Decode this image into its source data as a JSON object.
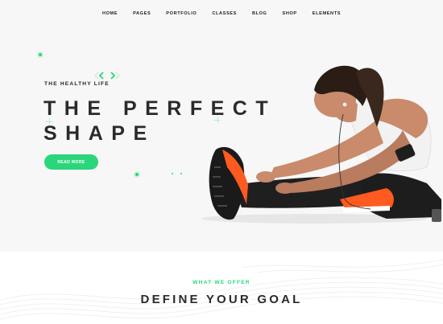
{
  "nav": {
    "items": [
      "HOME",
      "PAGES",
      "PORTFOLIO",
      "CLASSES",
      "BLOG",
      "SHOP",
      "ELEMENTS"
    ]
  },
  "hero": {
    "eyebrow": "THE HEALTHY LIFE",
    "headline_line1": "THE PERFECT",
    "headline_line2": "SHAPE",
    "cta_label": "READ MORE",
    "image": "athlete-stretching-image"
  },
  "offer": {
    "kicker": "WHAT WE OFFER",
    "title": "DEFINE YOUR GOAL"
  },
  "colors": {
    "accent": "#2bd67b",
    "text": "#2a2a2a",
    "background": "#f7f7f7"
  }
}
